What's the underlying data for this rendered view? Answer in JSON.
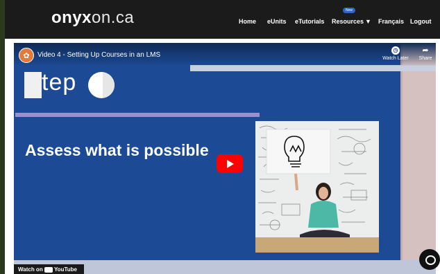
{
  "site": {
    "logo_strong": "onyx",
    "logo_light": "on.ca"
  },
  "nav": {
    "items": [
      "Home",
      "eUnits",
      "eTutorials",
      "Resources",
      "Français",
      "Logout"
    ],
    "new_badge": "New"
  },
  "video": {
    "title": "Video 4 - Setting Up Courses in an LMS",
    "watch_later": "Watch Later",
    "share": "Share",
    "step_text": "tep",
    "headline": "Assess what is possible",
    "watch_on": "Watch on",
    "watch_on_brand": "YouTube"
  },
  "colors": {
    "topbar": "#1b1b1b",
    "video_bg": "#1c4a94",
    "play_red": "#ff0000",
    "purple_line": "#9a8fd1"
  }
}
